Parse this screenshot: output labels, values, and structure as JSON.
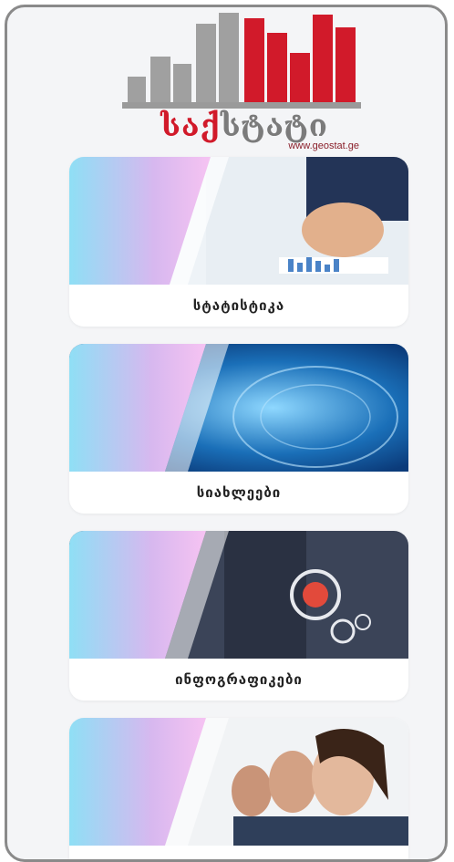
{
  "brand": {
    "logo_word_red": "საქ",
    "logo_word_grey": "სტატი",
    "url": "www.geostat.ge",
    "colors": {
      "red": "#d11a2a",
      "grey": "#9a9a9a"
    }
  },
  "menu": {
    "items": [
      {
        "label": "სტატისტიკა",
        "image": "statistics-chart-photo"
      },
      {
        "label": "სიახლეები",
        "image": "news-globe-photo"
      },
      {
        "label": "ინფოგრაფიკები",
        "image": "infographics-hand-photo"
      },
      {
        "label": "",
        "image": "call-center-photo"
      }
    ]
  }
}
